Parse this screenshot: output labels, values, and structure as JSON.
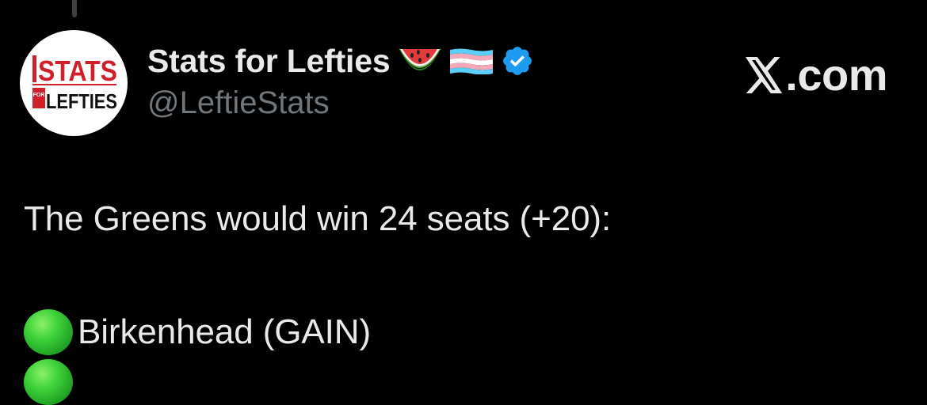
{
  "author": {
    "display_name": "Stats for Lefties",
    "handle": "@LeftieStats",
    "avatar_logo_top": "STATS",
    "avatar_logo_small": "FOR",
    "avatar_logo_bottom": "LEFTIES",
    "emojis": [
      "watermelon-icon",
      "transgender-flag-icon"
    ],
    "verified_badge": "verified-badge-icon",
    "verified_color": "#1d9bf0"
  },
  "source": {
    "label": ".com",
    "logo": "x-logo-icon"
  },
  "tweet": {
    "line_1": "The Greens would win 24 seats (+20):",
    "line_2_marker": "green-circle-icon",
    "line_2": "Birkenhead (GAIN)"
  },
  "colors": {
    "background": "#000000",
    "text": "#e7e9ea",
    "muted": "#71767b",
    "logo_red": "#d11f2a",
    "green": "#3fd33b"
  }
}
